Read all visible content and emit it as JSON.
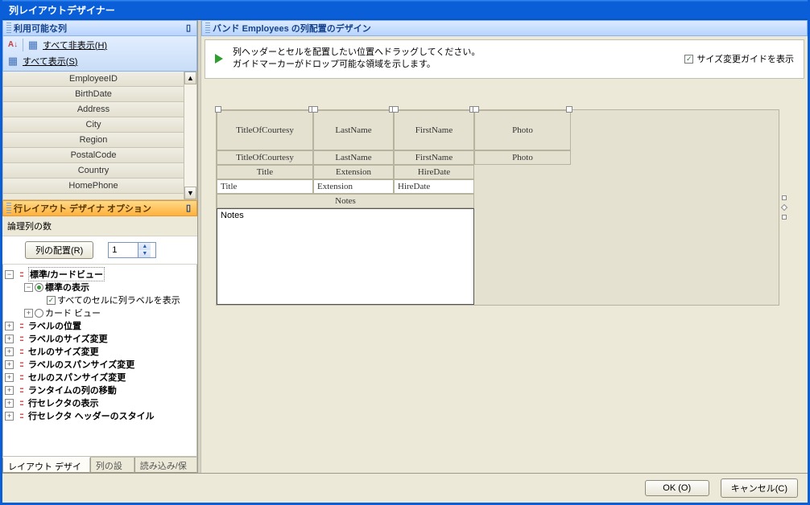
{
  "window": {
    "title": "列レイアウトデザイナー"
  },
  "left": {
    "available_header": "利用可能な列",
    "hide_all": "すべて非表示(",
    "hide_all_key": "H",
    "show_all": "すべて表示(",
    "show_all_key": "S",
    "columns": [
      "EmployeeID",
      "BirthDate",
      "Address",
      "City",
      "Region",
      "PostalCode",
      "Country",
      "HomePhone"
    ],
    "options_header": "行レイアウト デザイナ オプション",
    "logical_cols_label": "論理列の数",
    "arrange_btn": "列の配置(R)",
    "spin_value": "1",
    "tree": {
      "root": "標準/カードビュー",
      "standard_view": "標準の表示",
      "show_labels": "すべてのセルに列ラベルを表示",
      "card_view": "カード ビュー",
      "items": [
        "ラベルの位置",
        "ラベルのサイズ変更",
        "セルのサイズ変更",
        "ラベルのスパンサイズ変更",
        "セルのスパンサイズ変更",
        "ランタイムの列の移動",
        "行セレクタの表示",
        "行セレクタ ヘッダーのスタイル"
      ]
    },
    "tabs": [
      "レイアウト デザイン",
      "列の設定",
      "読み込み/保存"
    ]
  },
  "right": {
    "header_prefix": "バンド ",
    "header_band": "Employees",
    "header_suffix": " の列配置のデザイン",
    "hint1": "列ヘッダーとセルを配置したい位置へドラッグしてください。",
    "hint2": "ガイドマーカーがドロップ可能な領域を示します。",
    "guide_chk": "サイズ変更ガイドを表示",
    "headers": [
      "TitleOfCourtesy",
      "LastName",
      "FirstName",
      "Photo"
    ],
    "row1_labels": [
      "TitleOfCourtesy",
      "LastName",
      "FirstName",
      "Photo"
    ],
    "row2_labels": [
      "Title",
      "Extension",
      "HireDate"
    ],
    "row3_inputs": [
      "Title",
      "Extension",
      "HireDate"
    ],
    "notes_label": "Notes",
    "notes_input": "Notes"
  },
  "footer": {
    "ok": "OK (O)",
    "cancel": "キャンセル(C)"
  }
}
